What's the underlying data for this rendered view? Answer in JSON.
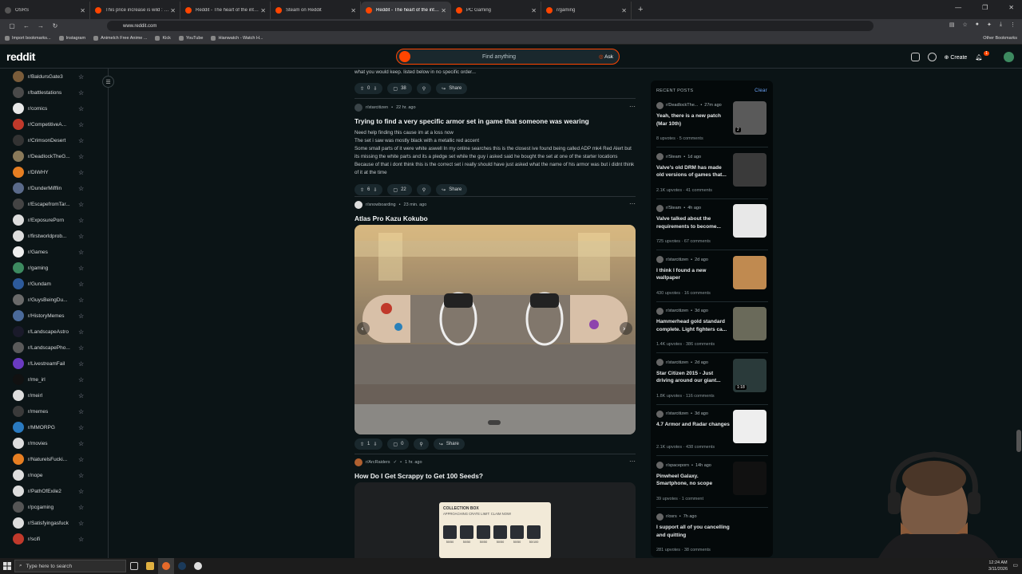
{
  "browser": {
    "tabs": [
      {
        "title": "OSRS",
        "active": false
      },
      {
        "title": "This price increase is wild : r/osrs",
        "active": false
      },
      {
        "title": "Reddit - The heart of the internet",
        "active": false
      },
      {
        "title": "Steam on Reddit",
        "active": false
      },
      {
        "title": "Reddit - The heart of the internet",
        "active": true
      },
      {
        "title": "PC Gaming",
        "active": false
      },
      {
        "title": "r/gaming",
        "active": false
      }
    ],
    "url": "www.reddit.com",
    "bookmarks": [
      "Import bookmarks...",
      "Instagram",
      "Animelch Free Anime ...",
      "Kick",
      "YouTube",
      "Hianwatch - Watch H..."
    ],
    "other_bookmarks": "Other Bookmarks"
  },
  "header": {
    "logo": "reddit",
    "search_placeholder": "Find anything",
    "ask_label": "Ask",
    "create_label": "Create",
    "notif_count": "1"
  },
  "sidebar": {
    "items": [
      {
        "label": "r/BaldursGate3",
        "color": "#7a5c3a"
      },
      {
        "label": "r/battlestations",
        "color": "#4a4a4a"
      },
      {
        "label": "r/comics",
        "color": "#e8e8e8"
      },
      {
        "label": "r/CompetitiveA...",
        "color": "#c0392b"
      },
      {
        "label": "r/CrimsonDesert",
        "color": "#333333"
      },
      {
        "label": "r/DeadlockTheG...",
        "color": "#8a7a5a"
      },
      {
        "label": "r/DIWHY",
        "color": "#e67e22"
      },
      {
        "label": "r/DunderMifflin",
        "color": "#5a6a8a"
      },
      {
        "label": "r/EscapefromTar...",
        "color": "#444444"
      },
      {
        "label": "r/ExposurePorn",
        "color": "#dddddd"
      },
      {
        "label": "r/firstworldprob...",
        "color": "#dddddd"
      },
      {
        "label": "r/Games",
        "color": "#eeeeee"
      },
      {
        "label": "r/gaming",
        "color": "#3d8a60"
      },
      {
        "label": "r/Gundam",
        "color": "#2d5a9a"
      },
      {
        "label": "r/GuysBeingDu...",
        "color": "#6a6a6a"
      },
      {
        "label": "r/HistoryMemes",
        "color": "#4a6a9a"
      },
      {
        "label": "r/LandscapeAstro",
        "color": "#1a1a2a"
      },
      {
        "label": "r/LandscapePho...",
        "color": "#5a5a5a"
      },
      {
        "label": "r/LivestreamFail",
        "color": "#6a3ac0"
      },
      {
        "label": "r/me_irl",
        "color": "#111111"
      },
      {
        "label": "r/meirl",
        "color": "#dddddd"
      },
      {
        "label": "r/memes",
        "color": "#3a3a3a"
      },
      {
        "label": "r/MMORPG",
        "color": "#2a7ac0"
      },
      {
        "label": "r/movies",
        "color": "#dddddd"
      },
      {
        "label": "r/NaturelsFucki...",
        "color": "#e67e22"
      },
      {
        "label": "r/nope",
        "color": "#dddddd"
      },
      {
        "label": "r/PathOfExile2",
        "color": "#dddddd"
      },
      {
        "label": "r/pcgaming",
        "color": "#555555"
      },
      {
        "label": "r/Satisfyingasfuck",
        "color": "#dddddd"
      },
      {
        "label": "r/scifi",
        "color": "#c0392b"
      }
    ]
  },
  "feed": {
    "post0": {
      "body": "what you would keep. listed below in no specific order...",
      "up": "0",
      "comments": "38",
      "share": "Share"
    },
    "post1": {
      "sub": "r/starcitizen",
      "time": "22 hr. ago",
      "title": "Trying to find a very specific armor set in game that someone was wearing",
      "body": [
        "Need help finding this cause im at a loss now",
        "The set i saw was mostly black with a metallic red accent",
        "Some small parts of it were white aswell In my online searches this is the closest ive found being called ADP mk4 Red Alert but its missing the white parts and its a pledge set while the guy i asked said he bought the set at one of the starter locations Because of that i dont think this is the correct set i really should have just asked what the name of his armor was but i didnt think of it at the time"
      ],
      "up": "6",
      "comments": "22",
      "share": "Share"
    },
    "post2": {
      "sub": "r/snowboarding",
      "time": "23 min. ago",
      "title": "Atlas Pro Kazu Kokubo",
      "up": "1",
      "comments": "0",
      "share": "Share"
    },
    "post3": {
      "sub": "r/ArcRaiders",
      "time": "1 hr. ago",
      "title": "How Do I Get Scrappy to Get 100 Seeds?",
      "img_heading": "COLLECTION BOX",
      "img_sub": "APPROACHING CRATE LIMIT: CLAIM NOW!",
      "img_counts": [
        "50/50",
        "50/50",
        "50/50",
        "50/50",
        "50/50",
        "50/100"
      ]
    }
  },
  "recent": {
    "heading": "RECENT POSTS",
    "clear": "Clear",
    "items": [
      {
        "sub": "r/DeadlockThe...",
        "time": "27m ago",
        "title": "Yeah, there is a new patch (Mar 10th)",
        "meta": "8 upvotes · 5 comments",
        "thumb": "#5a5a5a",
        "badge": "2"
      },
      {
        "sub": "r/Steam",
        "time": "1d ago",
        "title": "Valve's old DRM has made old versions of games that...",
        "meta": "2.1K upvotes · 41 comments",
        "thumb": "#3a3a3a",
        "badge": ""
      },
      {
        "sub": "r/Steam",
        "time": "4h ago",
        "title": "Valve talked about the requirements to become...",
        "meta": "725 upvotes · 67 comments",
        "thumb": "#e8e8e8",
        "badge": ""
      },
      {
        "sub": "r/starcitizen",
        "time": "2d ago",
        "title": "I think I found a new wallpaper",
        "meta": "430 upvotes · 16 comments",
        "thumb": "#c08a50",
        "badge": ""
      },
      {
        "sub": "r/starcitizen",
        "time": "3d ago",
        "title": "Hammerhead gold standard complete. Light fighters ca...",
        "meta": "1.4K upvotes · 386 comments",
        "thumb": "#6a6a5a",
        "badge": ""
      },
      {
        "sub": "r/starcitizen",
        "time": "2d ago",
        "title": "Star Citizen 2015 - Just driving around our giant...",
        "meta": "1.8K upvotes · 116 comments",
        "thumb": "#2a3a3a",
        "badge": "1:18"
      },
      {
        "sub": "r/starcitizen",
        "time": "3d ago",
        "title": "4.7 Armor and Radar changes",
        "meta": "2.1K upvotes · 438 comments",
        "thumb": "#eeeeee",
        "badge": ""
      },
      {
        "sub": "r/spaceporn",
        "time": "14h ago",
        "title": "Pinwheel Galaxy. Smartphone, no scope",
        "meta": "39 upvotes · 1 comment",
        "thumb": "#111111",
        "badge": ""
      },
      {
        "sub": "r/osrs",
        "time": "7h ago",
        "title": "I support all of you cancelling and quitting",
        "meta": "281 upvotes · 38 comments",
        "thumb": "",
        "badge": ""
      }
    ]
  },
  "taskbar": {
    "search_placeholder": "Type here to search",
    "time": "12:24 AM",
    "date": "3/11/2026"
  }
}
